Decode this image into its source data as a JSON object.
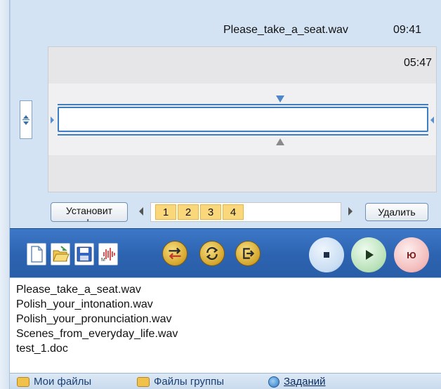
{
  "player": {
    "filename": "Please_take_a_seat.wav",
    "total_time": "09:41",
    "current_time": "05:47"
  },
  "controls": {
    "set_button": "Установит\nь",
    "set_button_line1": "Установит",
    "set_button_line2": "ь",
    "delete_button": "Удалить",
    "track_numbers": [
      "1",
      "2",
      "3",
      "4"
    ]
  },
  "toolbar": {
    "icons": [
      "new-document-icon",
      "open-folder-icon",
      "save-icon",
      "audio-waveform-icon",
      "shuffle-icon",
      "repeat-icon",
      "exit-icon",
      "stop-icon",
      "play-icon",
      "record-icon"
    ],
    "record_label": "Ю",
    "accent_gold": "#d4a52c",
    "bar_color": "#2c63b0"
  },
  "files": [
    "Please_take_a_seat.wav",
    "Polish_your_intonation.wav",
    "Polish_your_pronunciation.wav",
    "Scenes_from_everyday_life.wav",
    "test_1.doc"
  ],
  "tabs": [
    {
      "label": "Мои файлы",
      "icon": "users-folder-icon"
    },
    {
      "label": "Файлы группы",
      "icon": "group-folder-icon"
    },
    {
      "label": "Заданий",
      "icon": "globe-icon"
    }
  ]
}
